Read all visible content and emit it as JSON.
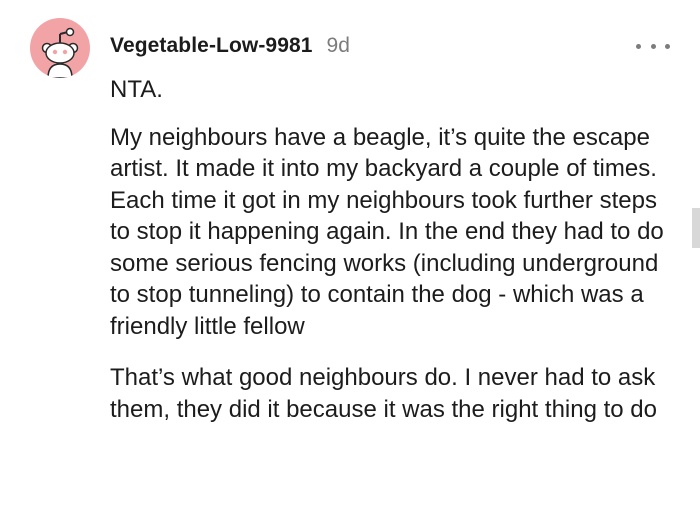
{
  "comment": {
    "username": "Vegetable-Low-9981",
    "timestamp": "9d",
    "more_icon": "more-horizontal-icon",
    "avatar_icon": "reddit-snoo-avatar-icon",
    "avatar_bg": "#f2a3a5",
    "paragraphs": [
      "NTA.",
      "My neighbours have a beagle, it’s quite the escape artist. It made it into my backyard a couple of times. Each time it got in my neighbours took further steps to stop it happening again. In the end they had to do some serious fencing works (including underground to stop tunneling) to contain the dog - which was a friendly little fellow",
      "That’s what good neighbours do. I never had to ask them, they did it because it was the right thing to do"
    ]
  }
}
